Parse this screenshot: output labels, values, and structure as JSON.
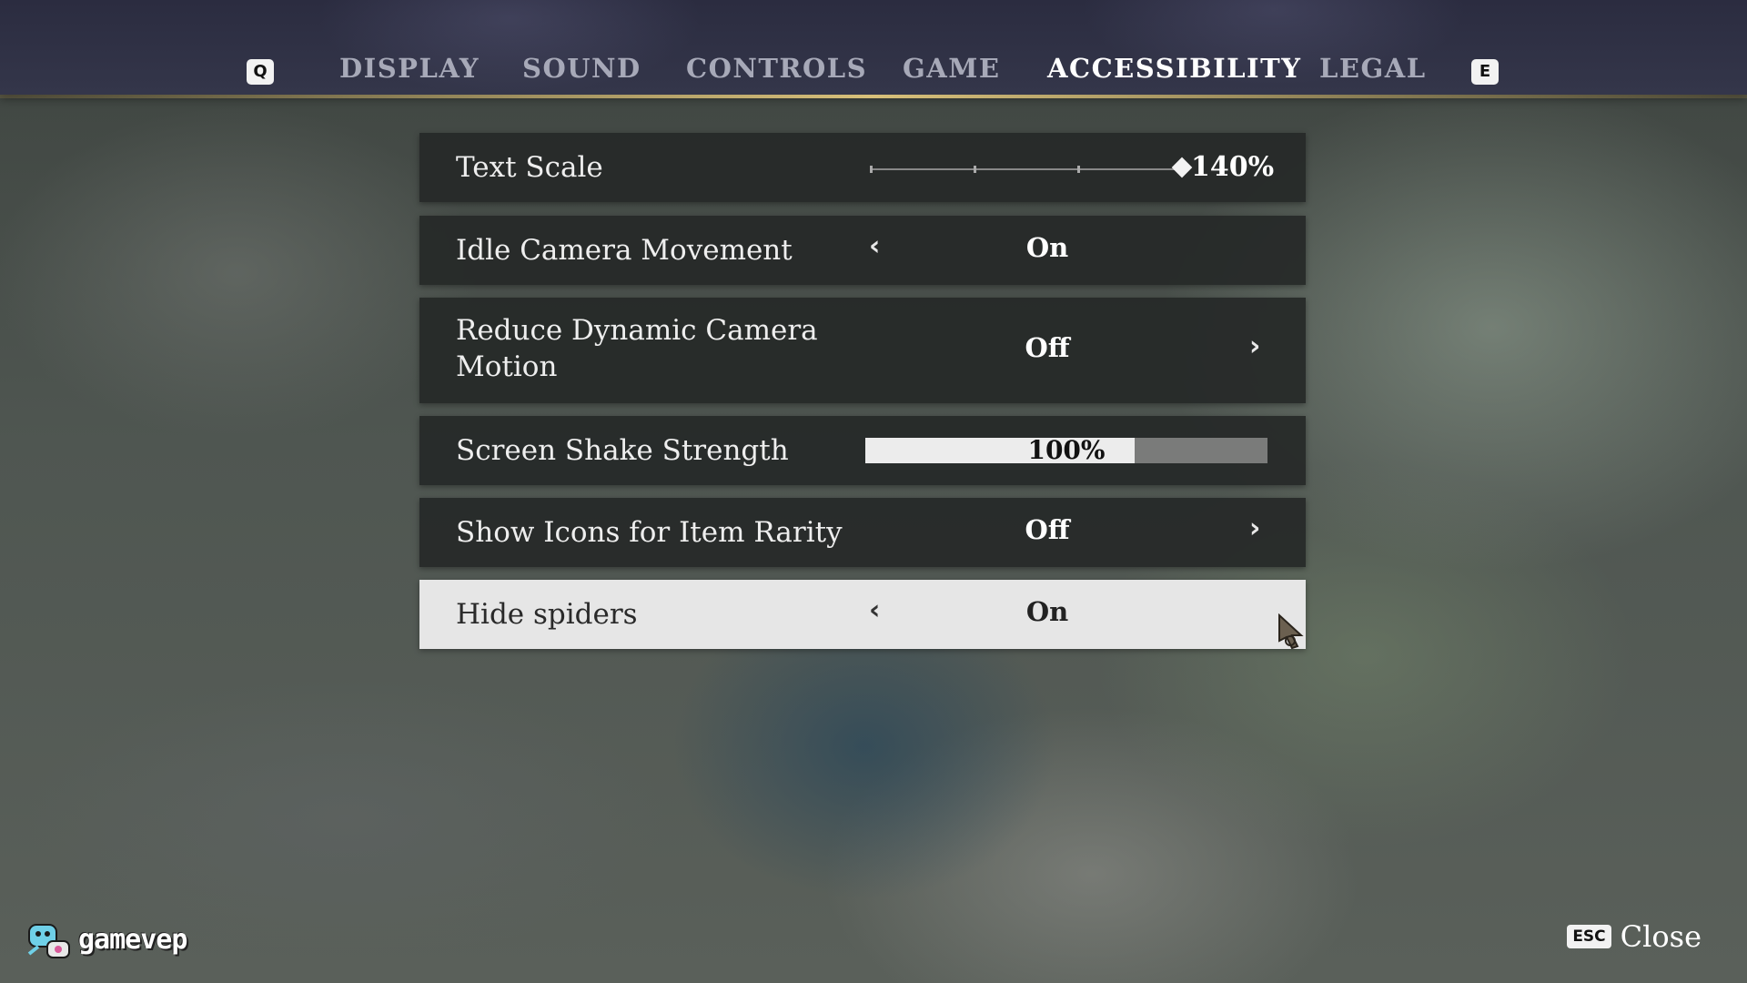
{
  "nav": {
    "prev_key": "Q",
    "next_key": "E",
    "tabs": [
      {
        "label": "DISPLAY",
        "active": false
      },
      {
        "label": "SOUND",
        "active": false
      },
      {
        "label": "CONTROLS",
        "active": false
      },
      {
        "label": "GAME",
        "active": false
      },
      {
        "label": "ACCESSIBILITY",
        "active": true
      },
      {
        "label": "LEGAL",
        "active": false
      }
    ]
  },
  "settings": {
    "text_scale": {
      "label": "Text Scale",
      "value": "140%",
      "level": 1.0
    },
    "idle_camera": {
      "label": "Idle Camera Movement",
      "value": "On"
    },
    "reduce_motion": {
      "label_line1": "Reduce Dynamic Camera",
      "label_line2": "Motion",
      "value": "Off"
    },
    "screen_shake": {
      "label": "Screen Shake Strength",
      "value": "100%",
      "fill_percent": 67
    },
    "item_rarity": {
      "label": "Show Icons for Item Rarity",
      "value": "Off"
    },
    "hide_spiders": {
      "label": "Hide spiders",
      "value": "On",
      "selected": true
    }
  },
  "footer": {
    "watermark": "gamevep",
    "close_key": "ESC",
    "close_label": "Close"
  },
  "colors": {
    "accent_gold": "#d8c07a",
    "active_tab": "#ffffff",
    "inactive_tab": "#a7a9b8",
    "row_bg": "#26292a",
    "selected_row_bg": "#e6e6e6"
  }
}
